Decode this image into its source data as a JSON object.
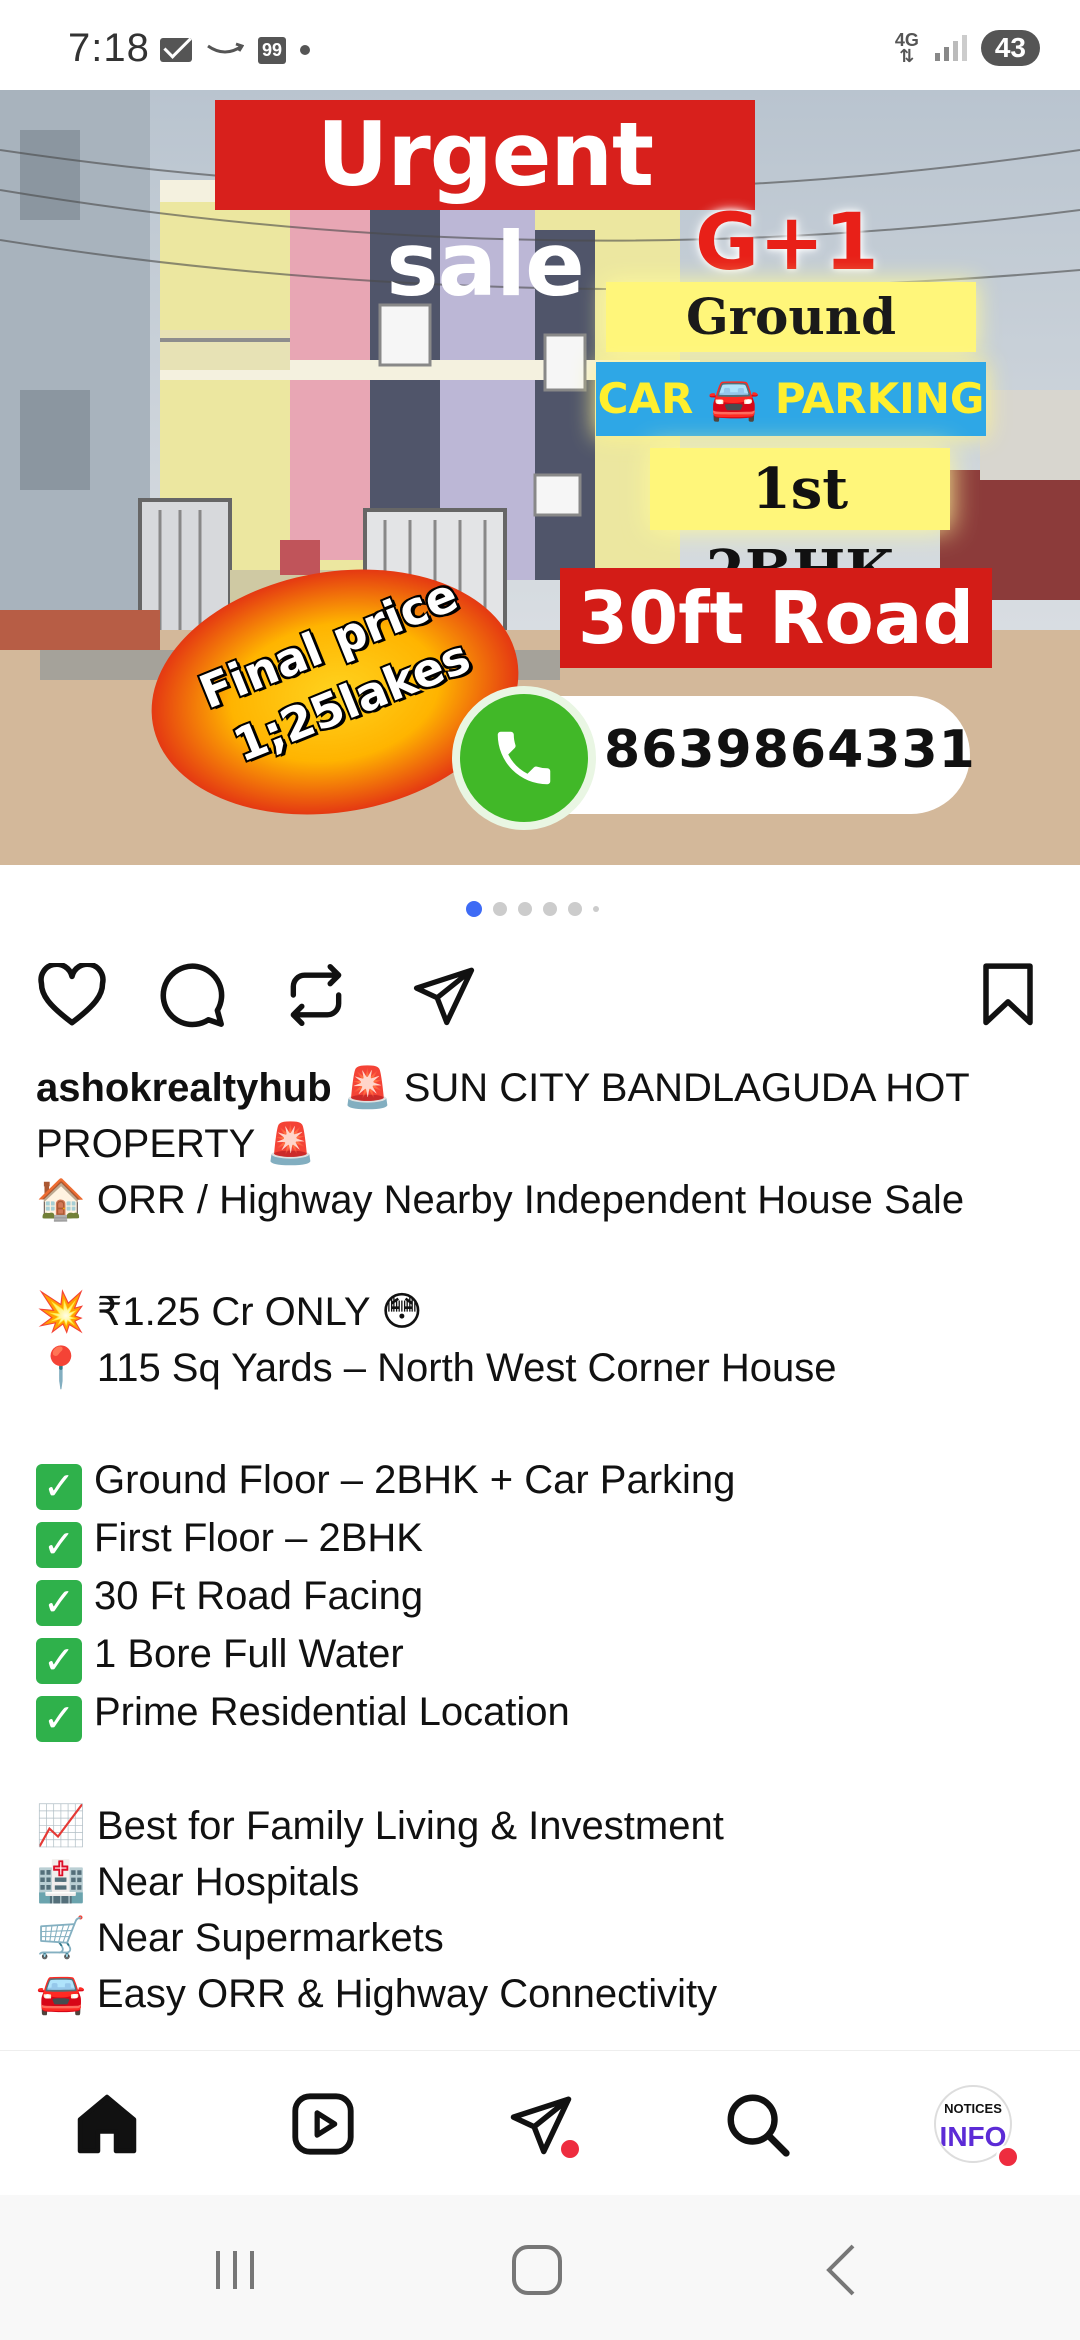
{
  "status_bar": {
    "time": "7:18",
    "badge": "99",
    "network_top": "4G",
    "network_bottom": "⇅",
    "battery": "43"
  },
  "post_image": {
    "headline": "Urgent sale",
    "floors": "G+1",
    "ground": "Ground 2BHK",
    "parking": "CAR 🚘 PARKING",
    "first": "1st 2BHK",
    "road": "30ft Road",
    "price_line1": "Final price",
    "price_line2": "1;25lakes",
    "phone": "8639864331"
  },
  "carousel": {
    "count": 6,
    "active_index": 0
  },
  "actions": {
    "like": "heart-icon",
    "comment": "comment-icon",
    "repost": "repost-icon",
    "share": "share-icon",
    "save": "bookmark-icon"
  },
  "caption": {
    "username": "ashokrealtyhub",
    "title": "🚨 SUN CITY BANDLAGUDA HOT PROPERTY 🚨",
    "subtitle": "🏠 ORR / Highway Nearby Independent House Sale",
    "price": "💥 ₹1.25 Cr ONLY 😳",
    "size": "📍 115 Sq Yards – North West Corner House",
    "features": [
      "Ground Floor – 2BHK + Car Parking",
      "First Floor – 2BHK",
      "30 Ft Road Facing",
      "1 Bore Full Water",
      "Prime Residential Location"
    ],
    "benefits": [
      "📈 Best for Family Living & Investment",
      "🏥 Near Hospitals",
      "🛒 Near Supermarkets",
      "🚘 Easy ORR & Highway Connectivity"
    ]
  },
  "bottom_nav": {
    "items": [
      "home-icon",
      "reels-icon",
      "messages-icon",
      "search-icon",
      "profile-avatar"
    ],
    "profile_line1": "NOTICES",
    "profile_line2": "INFO",
    "accent_color": "#ee2c3f"
  },
  "system_nav": [
    "recents-button",
    "home-button",
    "back-button"
  ]
}
